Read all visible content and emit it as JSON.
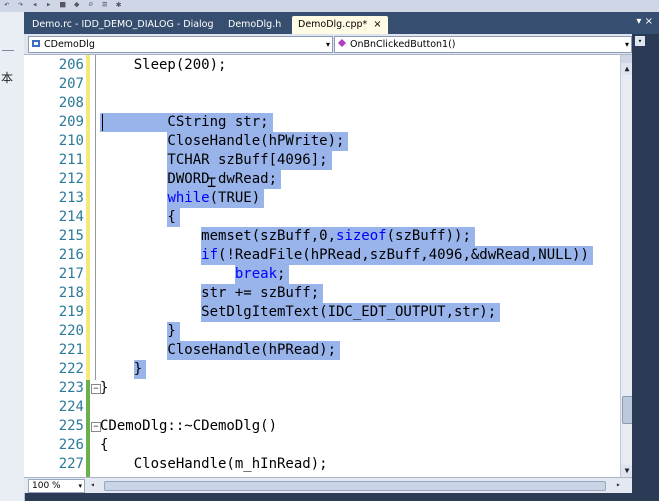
{
  "tabs": [
    {
      "label": "Demo.rc - IDD_DEMO_DIALOG - Dialog",
      "active": false
    },
    {
      "label": "DemoDlg.h",
      "active": false
    },
    {
      "label": "DemoDlg.cpp*",
      "active": true
    }
  ],
  "tab_close_glyph": "×",
  "tab_scroll_glyph": "▾ ×",
  "nav": {
    "class_combo": "CDemoDlg",
    "method_combo": "OnBnClickedButton1()"
  },
  "left_panel_glyph": "本",
  "lines": [
    {
      "num": "206",
      "text": "    Sleep(200);"
    },
    {
      "num": "207",
      "text": ""
    },
    {
      "num": "208",
      "text": ""
    },
    {
      "num": "209",
      "text": "        CString str;"
    },
    {
      "num": "210",
      "text": "        CloseHandle(hPWrite);"
    },
    {
      "num": "211",
      "text": "        TCHAR szBuff[4096];"
    },
    {
      "num": "212",
      "text": "        DWORD dwRead;"
    },
    {
      "num": "213",
      "text": "        while(TRUE)"
    },
    {
      "num": "214",
      "text": "        {"
    },
    {
      "num": "215",
      "text": "            memset(szBuff,0,sizeof(szBuff));"
    },
    {
      "num": "216",
      "text": "            if(!ReadFile(hPRead,szBuff,4096,&dwRead,NULL))"
    },
    {
      "num": "217",
      "text": "                break;"
    },
    {
      "num": "218",
      "text": "            str += szBuff;"
    },
    {
      "num": "219",
      "text": "            SetDlgItemText(IDC_EDT_OUTPUT,str);"
    },
    {
      "num": "220",
      "text": "        }"
    },
    {
      "num": "221",
      "text": "        CloseHandle(hPRead);"
    },
    {
      "num": "222",
      "text": "    }"
    },
    {
      "num": "223",
      "text": "}"
    },
    {
      "num": "224",
      "text": ""
    },
    {
      "num": "225",
      "text": "CDemoDlg::~CDemoDlg()"
    },
    {
      "num": "226",
      "text": "{"
    },
    {
      "num": "227",
      "text": "    CloseHandle(m_hInRead);"
    }
  ],
  "zoom": "100 %",
  "colors": {
    "selection": "#99b4ea",
    "keyword": "#0000ff",
    "line_number": "#2b7a9a",
    "tab_bar": "#364e6f"
  }
}
